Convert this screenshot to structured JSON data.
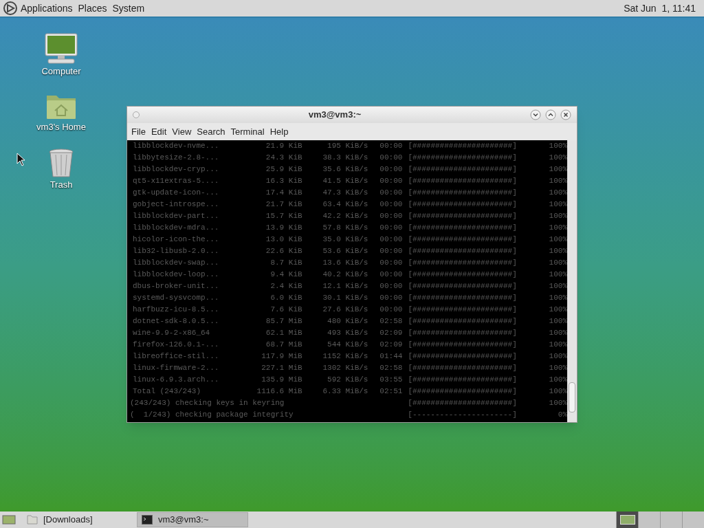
{
  "top_panel": {
    "menus": [
      "Applications",
      "Places",
      "System"
    ],
    "clock": "Sat Jun  1, 11:41"
  },
  "desktop_icons": [
    {
      "kind": "computer",
      "label": "Computer"
    },
    {
      "kind": "home",
      "label": "vm3's Home"
    },
    {
      "kind": "trash",
      "label": "Trash"
    }
  ],
  "window": {
    "title": "vm3@vm3:~",
    "menu": [
      "File",
      "Edit",
      "View",
      "Search",
      "Terminal",
      "Help"
    ],
    "terminal_rows": [
      {
        "kind": "download",
        "name": "libblockdev-nvme...",
        "size": "21.9 KiB",
        "speed": "195 KiB/s",
        "time": "00:00",
        "bar": "[######################]",
        "percent": "100%"
      },
      {
        "kind": "download",
        "name": "libbytesize-2.8-...",
        "size": "24.3 KiB",
        "speed": "38.3 KiB/s",
        "time": "00:00",
        "bar": "[######################]",
        "percent": "100%"
      },
      {
        "kind": "download",
        "name": "libblockdev-cryp...",
        "size": "25.9 KiB",
        "speed": "35.6 KiB/s",
        "time": "00:00",
        "bar": "[######################]",
        "percent": "100%"
      },
      {
        "kind": "download",
        "name": "qt5-x11extras-5....",
        "size": "16.3 KiB",
        "speed": "41.5 KiB/s",
        "time": "00:00",
        "bar": "[######################]",
        "percent": "100%"
      },
      {
        "kind": "download",
        "name": "gtk-update-icon-...",
        "size": "17.4 KiB",
        "speed": "47.3 KiB/s",
        "time": "00:00",
        "bar": "[######################]",
        "percent": "100%"
      },
      {
        "kind": "download",
        "name": "gobject-introspe...",
        "size": "21.7 KiB",
        "speed": "63.4 KiB/s",
        "time": "00:00",
        "bar": "[######################]",
        "percent": "100%"
      },
      {
        "kind": "download",
        "name": "libblockdev-part...",
        "size": "15.7 KiB",
        "speed": "42.2 KiB/s",
        "time": "00:00",
        "bar": "[######################]",
        "percent": "100%"
      },
      {
        "kind": "download",
        "name": "libblockdev-mdra...",
        "size": "13.9 KiB",
        "speed": "57.8 KiB/s",
        "time": "00:00",
        "bar": "[######################]",
        "percent": "100%"
      },
      {
        "kind": "download",
        "name": "hicolor-icon-the...",
        "size": "13.0 KiB",
        "speed": "35.0 KiB/s",
        "time": "00:00",
        "bar": "[######################]",
        "percent": "100%"
      },
      {
        "kind": "download",
        "name": "lib32-libusb-2.0...",
        "size": "22.6 KiB",
        "speed": "53.6 KiB/s",
        "time": "00:00",
        "bar": "[######################]",
        "percent": "100%"
      },
      {
        "kind": "download",
        "name": "libblockdev-swap...",
        "size": "8.7 KiB",
        "speed": "13.6 KiB/s",
        "time": "00:00",
        "bar": "[######################]",
        "percent": "100%"
      },
      {
        "kind": "download",
        "name": "libblockdev-loop...",
        "size": "9.4 KiB",
        "speed": "40.2 KiB/s",
        "time": "00:00",
        "bar": "[######################]",
        "percent": "100%"
      },
      {
        "kind": "download",
        "name": "dbus-broker-unit...",
        "size": "2.4 KiB",
        "speed": "12.1 KiB/s",
        "time": "00:00",
        "bar": "[######################]",
        "percent": "100%"
      },
      {
        "kind": "download",
        "name": "systemd-sysvcomp...",
        "size": "6.0 KiB",
        "speed": "30.1 KiB/s",
        "time": "00:00",
        "bar": "[######################]",
        "percent": "100%"
      },
      {
        "kind": "download",
        "name": "harfbuzz-icu-8.5...",
        "size": "7.6 KiB",
        "speed": "27.6 KiB/s",
        "time": "00:00",
        "bar": "[######################]",
        "percent": "100%"
      },
      {
        "kind": "download",
        "name": "dotnet-sdk-8.0.5...",
        "size": "85.7 MiB",
        "speed": "480 KiB/s",
        "time": "02:58",
        "bar": "[######################]",
        "percent": "100%"
      },
      {
        "kind": "download",
        "name": "wine-9.9-2-x86_64",
        "size": "62.1 MiB",
        "speed": "493 KiB/s",
        "time": "02:09",
        "bar": "[######################]",
        "percent": "100%"
      },
      {
        "kind": "download",
        "name": "firefox-126.0.1-...",
        "size": "68.7 MiB",
        "speed": "544 KiB/s",
        "time": "02:09",
        "bar": "[######################]",
        "percent": "100%"
      },
      {
        "kind": "download",
        "name": "libreoffice-stil...",
        "size": "117.9 MiB",
        "speed": "1152 KiB/s",
        "time": "01:44",
        "bar": "[######################]",
        "percent": "100%"
      },
      {
        "kind": "download",
        "name": "linux-firmware-2...",
        "size": "227.1 MiB",
        "speed": "1302 KiB/s",
        "time": "02:58",
        "bar": "[######################]",
        "percent": "100%"
      },
      {
        "kind": "download",
        "name": "linux-6.9.3.arch...",
        "size": "135.9 MiB",
        "speed": "592 KiB/s",
        "time": "03:55",
        "bar": "[######################]",
        "percent": "100%"
      },
      {
        "kind": "download",
        "name": "Total (243/243)",
        "size": "1116.6 MiB",
        "speed": "6.33 MiB/s",
        "time": "02:51",
        "bar": "[######################]",
        "percent": "100%"
      },
      {
        "kind": "step",
        "name": "(243/243) checking keys in keyring",
        "bar": "[######################]",
        "percent": "100%"
      },
      {
        "kind": "step",
        "name": "(  1/243) checking package integrity",
        "bar": "[----------------------]",
        "percent": "0%"
      }
    ]
  },
  "bottom_panel": {
    "tasks": [
      {
        "kind": "folder",
        "label": "[Downloads]",
        "selected": false
      },
      {
        "kind": "terminal",
        "label": "vm3@vm3:~",
        "selected": true
      }
    ],
    "workspaces": [
      {
        "selected": true
      },
      {
        "selected": false
      },
      {
        "selected": false
      },
      {
        "selected": false
      }
    ]
  }
}
